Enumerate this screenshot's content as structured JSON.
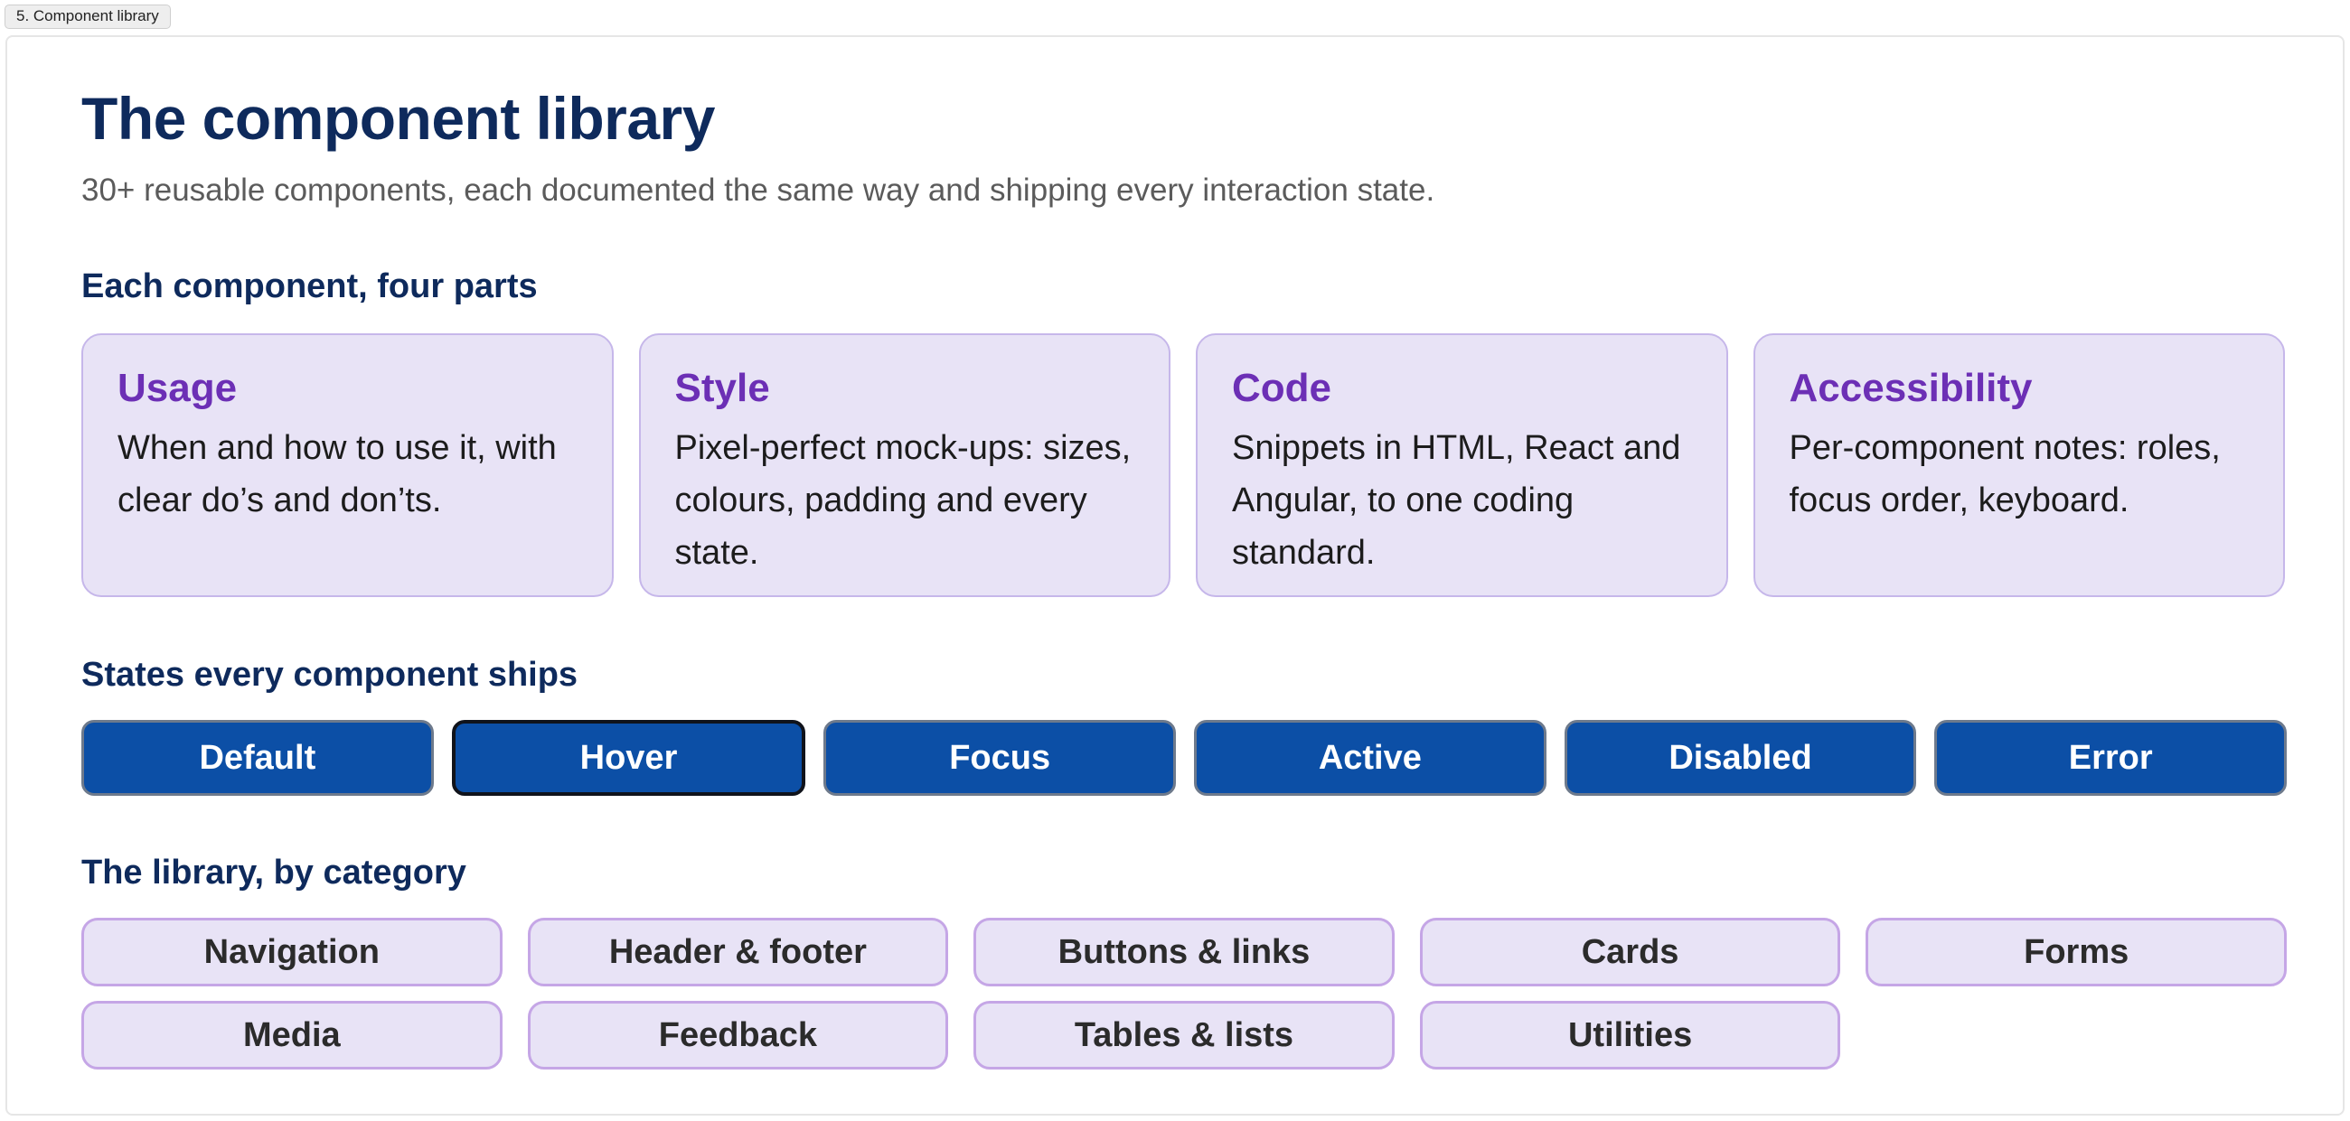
{
  "tab": {
    "label": "5. Component library"
  },
  "header": {
    "title": "The component library",
    "subtitle": "30+ reusable components, each documented the same way and shipping every interaction state."
  },
  "parts_section": {
    "heading": "Each component, four parts",
    "cards": [
      {
        "title": "Usage",
        "desc": "When and how to use it, with clear do’s and don’ts."
      },
      {
        "title": "Style",
        "desc": "Pixel-perfect mock-ups: sizes, colours, padding and every state."
      },
      {
        "title": "Code",
        "desc": "Snippets in HTML, React and Angular, to one coding standard."
      },
      {
        "title": "Accessibility",
        "desc": "Per-component notes: roles, focus order, keyboard."
      }
    ]
  },
  "states_section": {
    "heading": "States every component ships",
    "states": [
      "Default",
      "Hover",
      "Focus",
      "Active",
      "Disabled",
      "Error"
    ]
  },
  "categories_section": {
    "heading": "The library, by category",
    "categories": [
      "Navigation",
      "Header & footer",
      "Buttons & links",
      "Cards",
      "Forms",
      "Media",
      "Feedback",
      "Tables & lists",
      "Utilities"
    ]
  },
  "colors": {
    "heading": "#0e2a5c",
    "card_title": "#6c2fb5",
    "card_bg": "#e8e3f6",
    "state_button_bg": "#0c4fa6"
  }
}
